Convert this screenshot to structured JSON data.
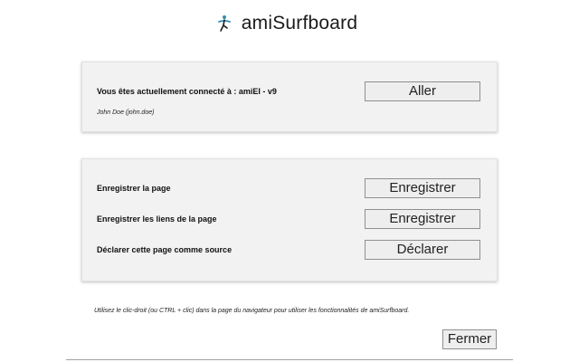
{
  "header": {
    "logo_icon": "surfer-icon",
    "title": "amiSurfboard",
    "accent_color": "#2f8fb5"
  },
  "connection": {
    "status_label": "Vous êtes actuellement connecté à : amiEI - v9",
    "user": "John Doe (john.doe)",
    "go_button": "Aller"
  },
  "actions": {
    "items": [
      {
        "label": "Enregistrer la page",
        "button": "Enregistrer"
      },
      {
        "label": "Enregistrer les liens de la page",
        "button": "Enregistrer"
      },
      {
        "label": "Déclarer cette page comme source",
        "button": "Déclarer"
      }
    ]
  },
  "hint": "Utilisez le clic-droit (ou CTRL + clic) dans la page du navigateur pour utiliser les fonctionnalités de amiSurfboard.",
  "close_button": "Fermer"
}
